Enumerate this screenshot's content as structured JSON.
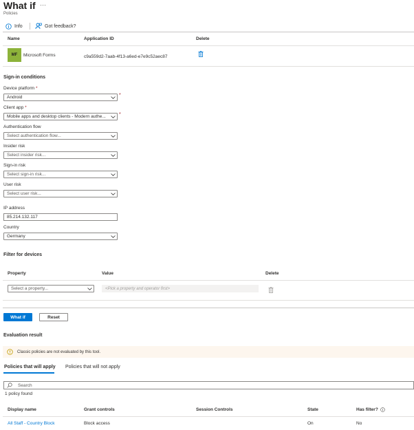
{
  "header": {
    "title": "What if",
    "more": "···",
    "breadcrumb": "Policies"
  },
  "commands": {
    "info": "Info",
    "feedback": "Got feedback?"
  },
  "apps_table": {
    "columns": {
      "name": "Name",
      "application_id": "Application ID",
      "delete": "Delete"
    },
    "rows": [
      {
        "initials": "MF",
        "name": "Microsoft Forms",
        "application_id": "c9a559d2-7aab-4f13-a6ed-e7e9c52aec87"
      }
    ]
  },
  "sign_in": {
    "heading": "Sign-in conditions",
    "device_platform": {
      "label": "Device platform",
      "required": "*",
      "value": "Android"
    },
    "client_app": {
      "label": "Client app",
      "required": "*",
      "value": "Mobile apps and desktop clients - Modern authe..."
    },
    "auth_flow": {
      "label": "Authentication flow",
      "placeholder": "Select authentication flow..."
    },
    "insider_risk": {
      "label": "Insider risk",
      "placeholder": "Select insider risk..."
    },
    "sign_in_risk": {
      "label": "Sign-in risk",
      "placeholder": "Select sign-in risk..."
    },
    "user_risk": {
      "label": "User risk",
      "placeholder": "Select user risk..."
    },
    "ip_address": {
      "label": "IP address",
      "value": "85.214.132.117"
    },
    "country": {
      "label": "Country",
      "value": "Germany"
    }
  },
  "filter_devices": {
    "heading": "Filter for devices",
    "columns": {
      "property": "Property",
      "value": "Value",
      "delete": "Delete"
    },
    "property_placeholder": "Select a property...",
    "value_placeholder": "<Pick a property and operator first>"
  },
  "actions": {
    "what_if": "What if",
    "reset": "Reset"
  },
  "evaluation": {
    "heading": "Evaluation result",
    "banner": "Classic policies are not evaluated by this tool.",
    "tabs": [
      "Policies that will apply",
      "Policies that will not apply"
    ],
    "search_placeholder": "Search",
    "count": "1 policy found",
    "columns": {
      "display_name": "Display name",
      "grant_controls": "Grant controls",
      "session_controls": "Session Controls",
      "state": "State",
      "has_filter": "Has filter?"
    },
    "rows": [
      {
        "display_name": "All Staff - Country Block",
        "grant_controls": "Block access",
        "session_controls": "",
        "state": "On",
        "has_filter": "No"
      }
    ]
  },
  "colors": {
    "accent": "#0078d4",
    "avatar": "#8db33a",
    "banner_bg": "#fdf6ee",
    "warning_icon": "#c19c00"
  }
}
